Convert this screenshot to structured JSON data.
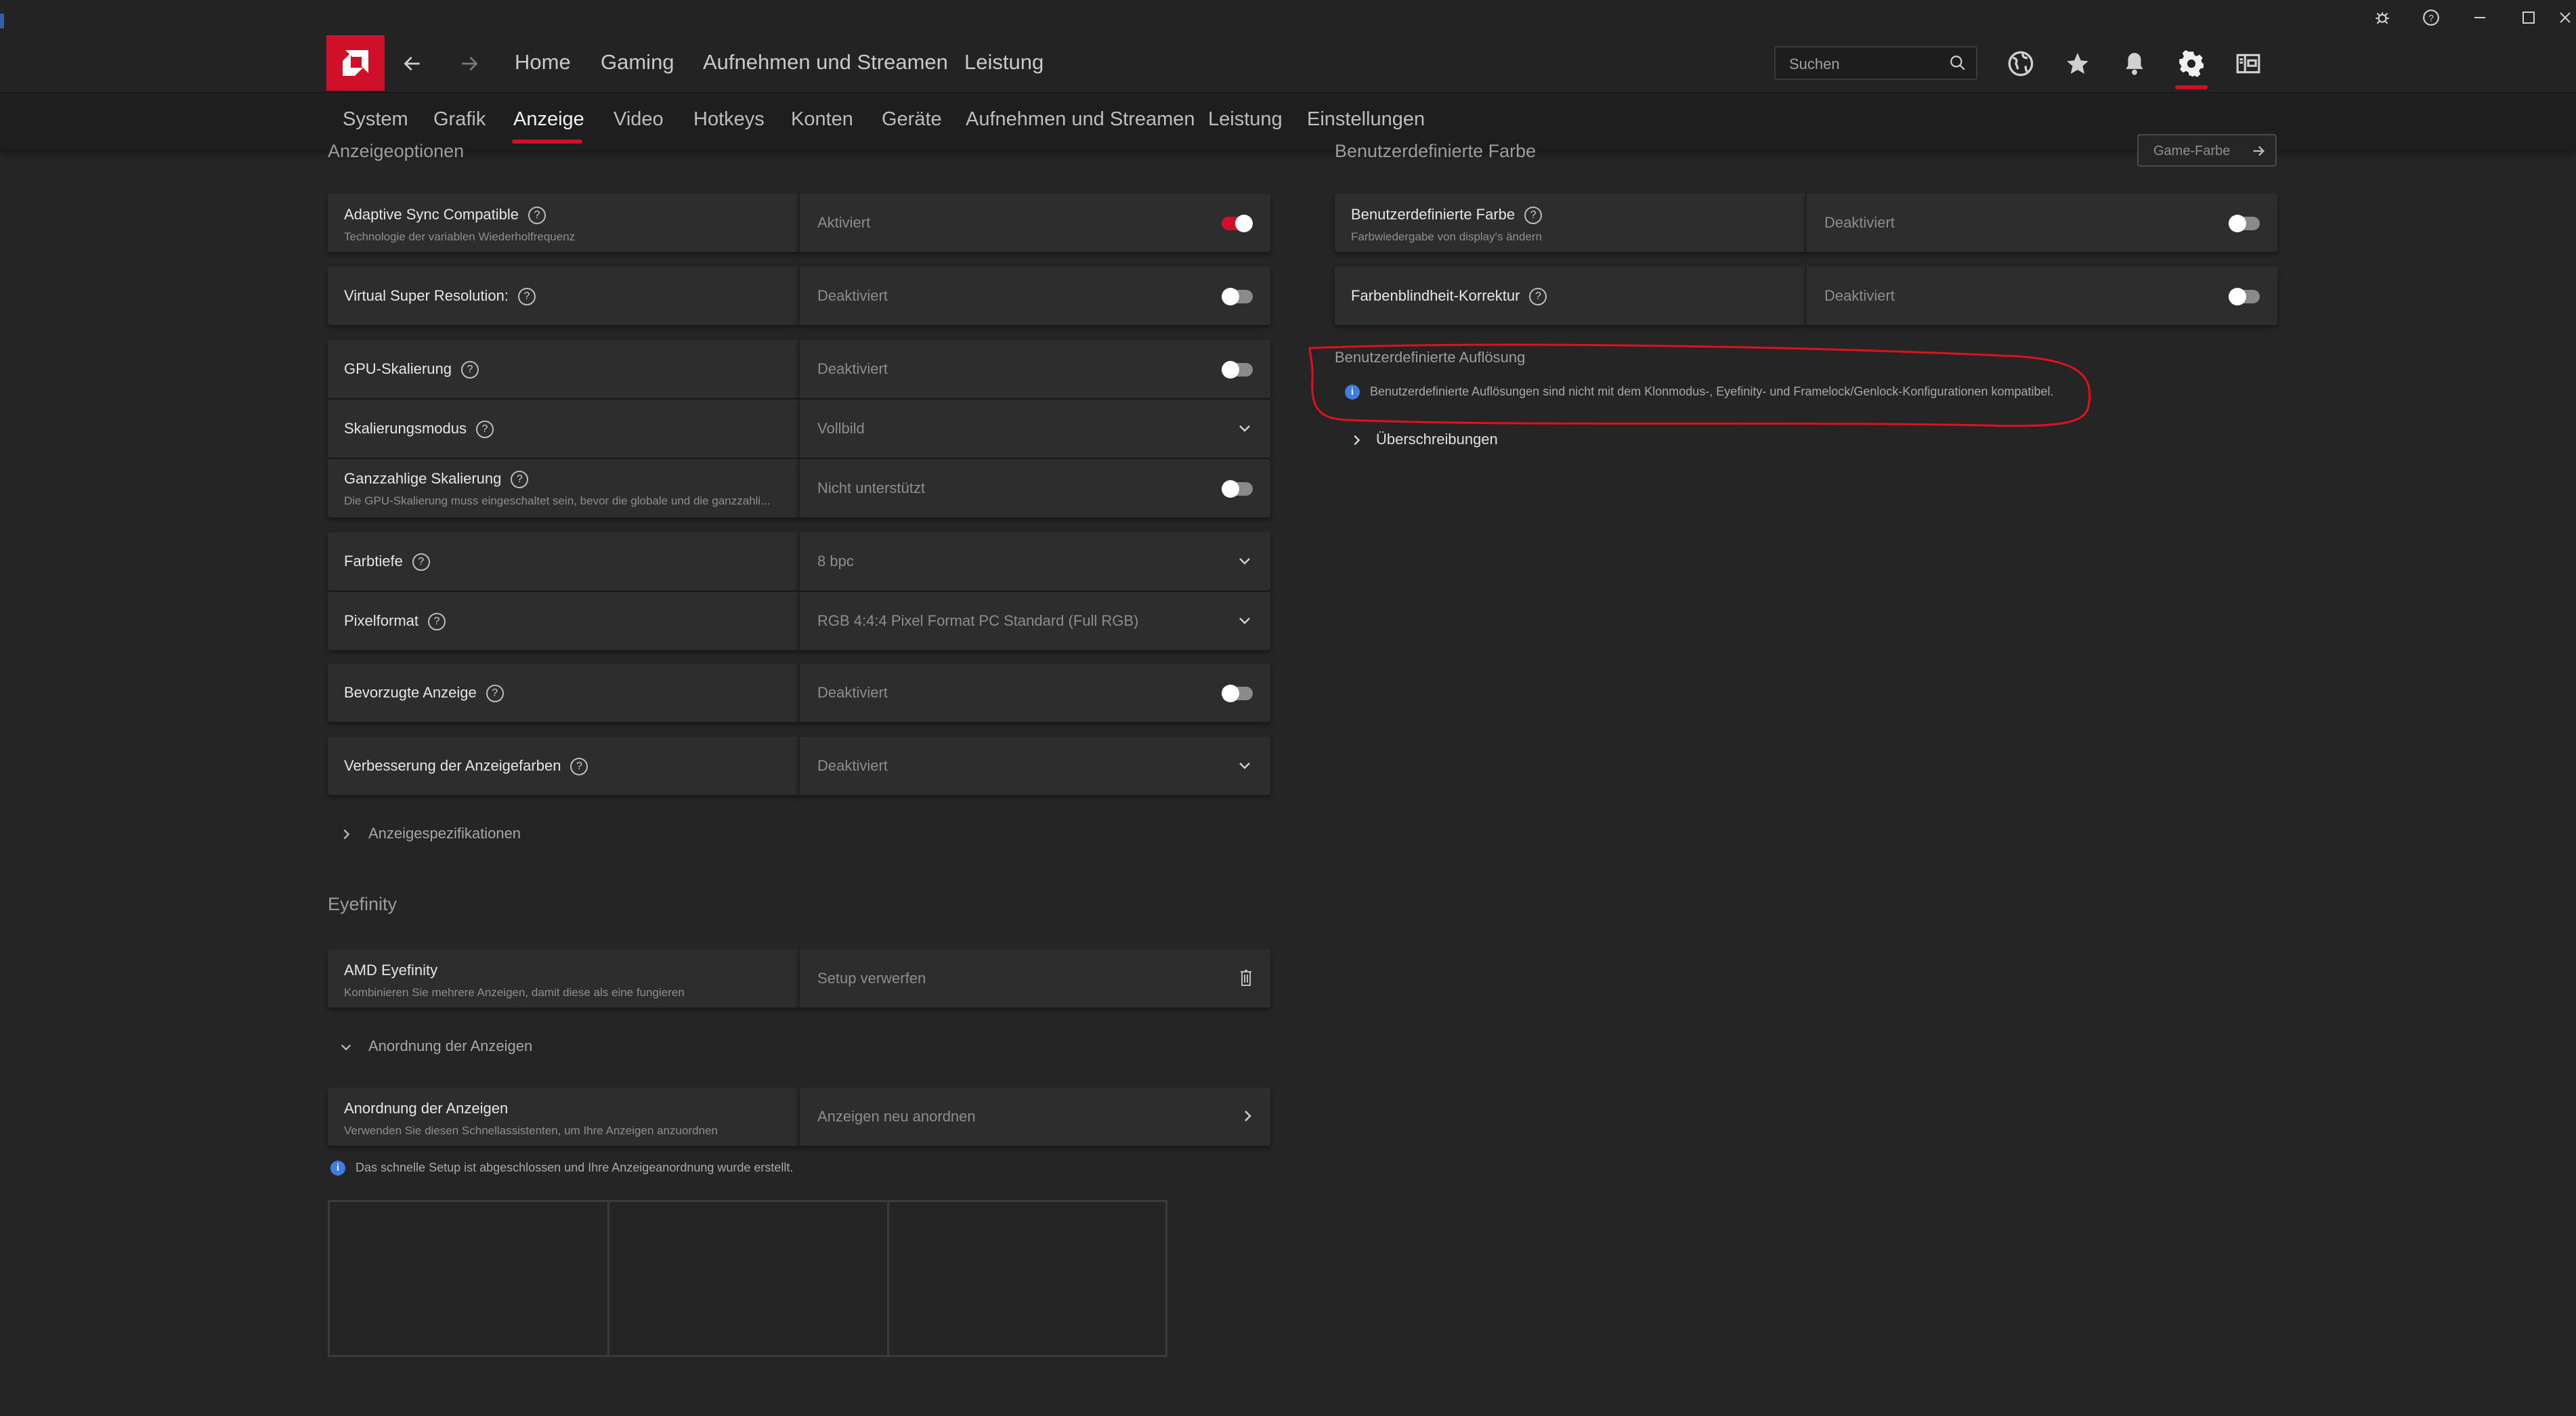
{
  "window": {
    "controls": [
      {
        "name": "bug-report-icon",
        "glyph": "✲"
      },
      {
        "name": "help-icon",
        "glyph": "?"
      },
      {
        "name": "minimize-icon",
        "glyph": "—"
      },
      {
        "name": "maximize-icon",
        "glyph": "☐"
      },
      {
        "name": "close-icon",
        "glyph": "✕"
      }
    ]
  },
  "topnav": {
    "items": [
      "Home",
      "Gaming",
      "Aufnehmen und Streamen",
      "Leistung"
    ],
    "search_placeholder": "Suchen",
    "icons": [
      "globe-icon",
      "star-icon",
      "bell-icon",
      "gear-icon",
      "sidebar-icon"
    ],
    "active_icon": "gear-icon"
  },
  "subnav": {
    "tabs": [
      "System",
      "Grafik",
      "Anzeige",
      "Video",
      "Hotkeys",
      "Konten",
      "Geräte",
      "Aufnehmen und Streamen",
      "Leistung",
      "Einstellungen"
    ],
    "active": "Anzeige"
  },
  "left": {
    "section_title": "Anzeigeoptionen",
    "rows": [
      {
        "label": "Adaptive Sync Compatible",
        "sub": "Technologie der variablen Wiederholfrequenz",
        "value": "Aktiviert",
        "control": "toggle",
        "on": true
      },
      {
        "label": "Virtual Super Resolution:",
        "sub": "",
        "value": "Deaktiviert",
        "control": "toggle",
        "on": false
      },
      {
        "label": "GPU-Skalierung",
        "sub": "",
        "value": "Deaktiviert",
        "control": "toggle",
        "on": false
      },
      {
        "label": "Skalierungsmodus",
        "sub": "",
        "value": "Vollbild",
        "control": "dropdown"
      },
      {
        "label": "Ganzzahlige Skalierung",
        "sub": "Die GPU-Skalierung muss eingeschaltet sein, bevor die globale und die ganzzahli...",
        "value": "Nicht unterstützt",
        "control": "toggle",
        "on": false
      },
      {
        "label": "Farbtiefe",
        "sub": "",
        "value": "8 bpc",
        "control": "dropdown"
      },
      {
        "label": "Pixelformat",
        "sub": "",
        "value": "RGB 4:4:4 Pixel Format PC Standard (Full RGB)",
        "control": "dropdown"
      },
      {
        "label": "Bevorzugte Anzeige",
        "sub": "",
        "value": "Deaktiviert",
        "control": "toggle",
        "on": false
      },
      {
        "label": "Verbesserung der Anzeigefarben",
        "sub": "",
        "value": "Deaktiviert",
        "control": "dropdown"
      }
    ],
    "specs_label": "Anzeigespezifikationen",
    "eyefinity": {
      "title": "Eyefinity",
      "amd_row": {
        "label": "AMD Eyefinity",
        "sub": "Kombinieren Sie mehrere Anzeigen, damit diese als eine fungieren",
        "value": "Setup verwerfen"
      },
      "arrangement_collapse": "Anordnung der Anzeigen",
      "arrangement_row": {
        "label": "Anordnung der Anzeigen",
        "sub": "Verwenden Sie diesen Schnellassistenten, um Ihre Anzeigen anzuordnen",
        "value": "Anzeigen neu anordnen"
      },
      "info": "Das schnelle Setup ist abgeschlossen und Ihre Anzeigeanordnung wurde erstellt."
    }
  },
  "right": {
    "section_title": "Benutzerdefinierte Farbe",
    "game_color_button": "Game-Farbe",
    "rows": [
      {
        "label": "Benutzerdefinierte Farbe",
        "sub": "Farbwiedergabe von display's ändern",
        "value": "Deaktiviert",
        "on": false
      },
      {
        "label": "Farbenblindheit-Korrektur",
        "sub": "",
        "value": "Deaktiviert",
        "on": false
      }
    ],
    "custom_res": {
      "title": "Benutzerdefinierte Auflösung",
      "info": "Benutzerdefinierte Auflösungen sind nicht mit dem Klonmodus-, Eyefinity- und Framelock/Genlock-Konfigurationen kompatibel.",
      "overrides": "Überschreibungen"
    }
  },
  "colors": {
    "accent": "#d0102b",
    "annotation": "#e0101c",
    "info": "#3f7de0"
  }
}
